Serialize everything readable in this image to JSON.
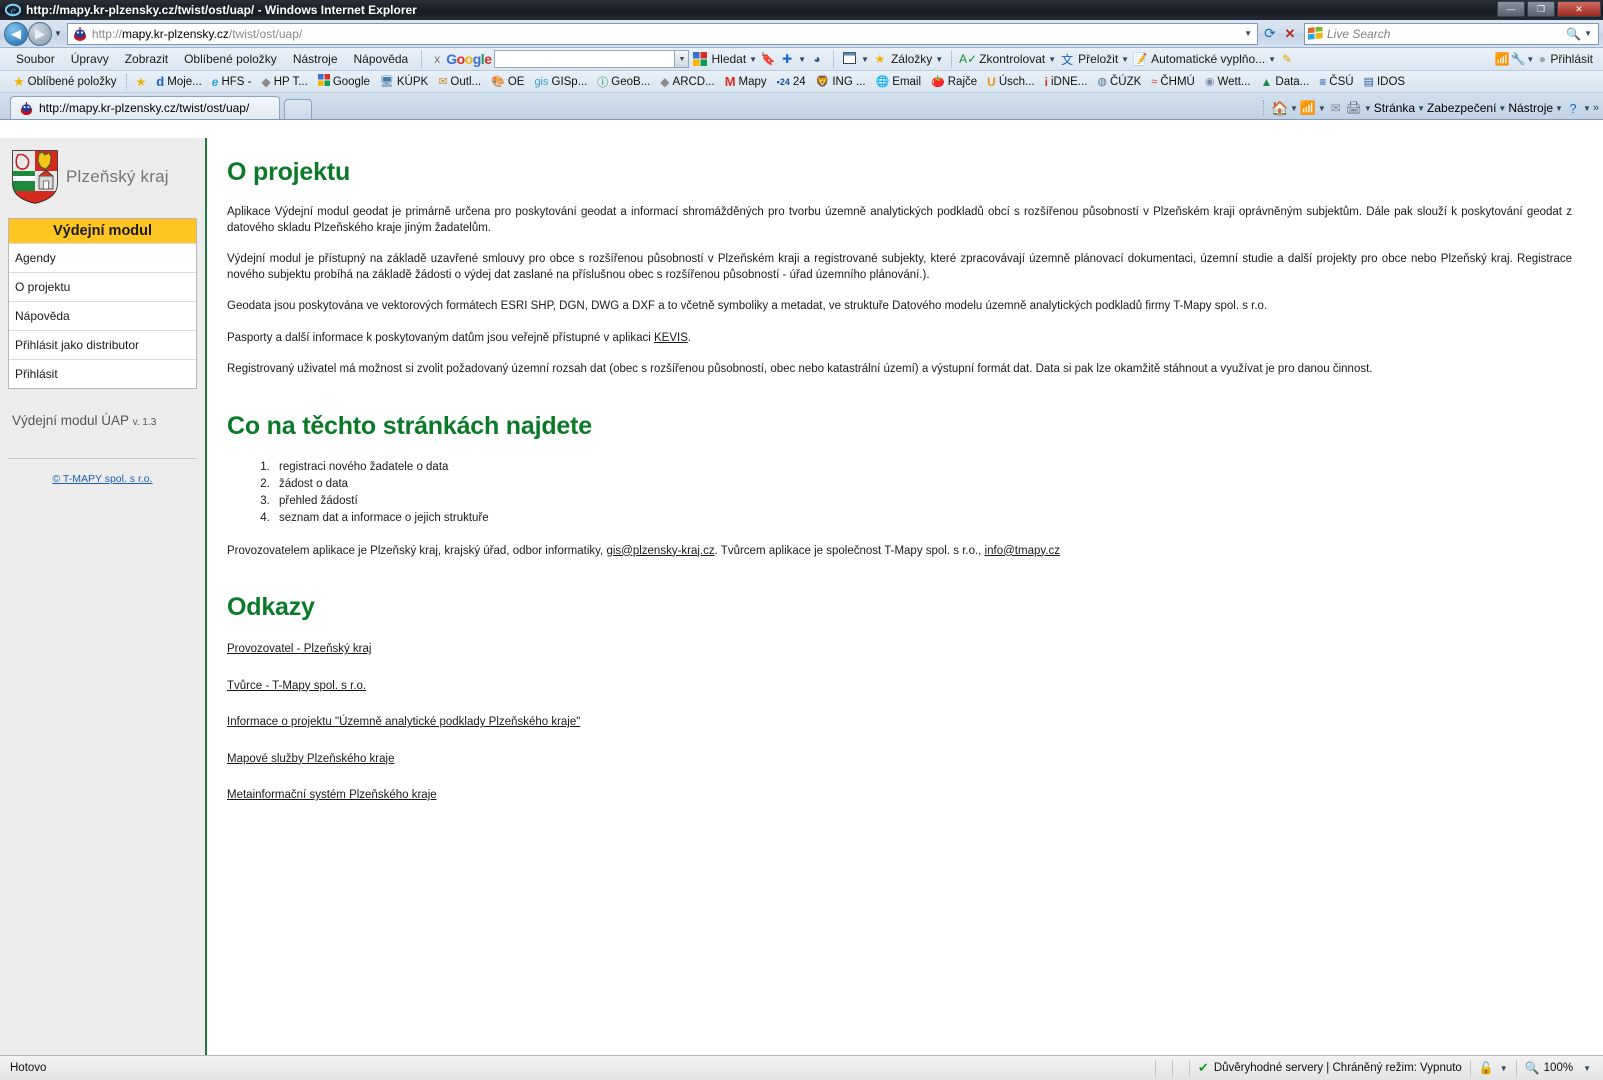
{
  "window": {
    "title": "http://mapy.kr-plzensky.cz/twist/ost/uap/ - Windows Internet Explorer",
    "minimize_label": "—",
    "maximize_label": "❐",
    "close_label": "✕"
  },
  "address_bar": {
    "url_prefix": "http://",
    "url_host": "mapy.kr-plzensky.cz",
    "url_path": "/twist/ost/uap/",
    "full_url": "http://mapy.kr-plzensky.cz/twist/ost/uap/",
    "back_icon": "back-arrow-icon",
    "forward_icon": "forward-arrow-icon",
    "history_dropdown_icon": "chevron-down-icon",
    "address_dropdown_icon": "chevron-down-icon",
    "refresh_icon": "refresh-icon",
    "stop_icon": "stop-icon",
    "search_placeholder": "Live Search",
    "search_icon": "magnifier-icon",
    "search_dropdown_icon": "chevron-down-icon"
  },
  "menu": {
    "items": [
      "Soubor",
      "Úpravy",
      "Zobrazit",
      "Oblíbené položky",
      "Nástroje",
      "Nápověda"
    ]
  },
  "google_toolbar": {
    "close_label": "x",
    "logo_letters": [
      "G",
      "o",
      "o",
      "g",
      "l",
      "e"
    ],
    "search_value": "",
    "search_dropdown_icon": "chevron-down-icon",
    "buttons": [
      {
        "label": "Hledat",
        "icon": "google-search-icon",
        "caret": true
      },
      {
        "label": "",
        "icon": "bookmarks-star-icon",
        "caret": false
      },
      {
        "label": "",
        "icon": "blue-plus-icon",
        "caret": true
      },
      {
        "label": "",
        "icon": "globe-icon",
        "caret": false
      },
      {
        "label": "",
        "icon": "popup-blocker-icon",
        "caret": true
      },
      {
        "label": "Záložky",
        "icon": "star-icon",
        "caret": true
      },
      {
        "label": "Zkontrolovat",
        "icon": "spellcheck-icon",
        "caret": true
      },
      {
        "label": "Přeložit",
        "icon": "translate-icon",
        "caret": true
      },
      {
        "label": "Automatické vyplňo...",
        "icon": "autofill-icon",
        "caret": true
      },
      {
        "label": "",
        "icon": "pencil-icon",
        "caret": false
      }
    ],
    "right_items": [
      {
        "label": "",
        "icon": "wifi-icon",
        "caret": false
      },
      {
        "label": "",
        "icon": "wrench-icon",
        "caret": true
      },
      {
        "label": "Přihlásit",
        "icon": "account-icon",
        "caret": true
      }
    ]
  },
  "favorites_bar": {
    "button_label": "Oblíbené položky",
    "button_icon": "star-icon",
    "add_icon": "add-favorite-icon",
    "items": [
      {
        "label": "Moje...",
        "icon": "d-blue-icon"
      },
      {
        "label": "HFS -",
        "icon": "ie-icon"
      },
      {
        "label": "HP T...",
        "icon": "diamond-grey-icon"
      },
      {
        "label": "Google",
        "icon": "google-g-icon"
      },
      {
        "label": "KÚPK",
        "icon": "computer-icon"
      },
      {
        "label": "Outl...",
        "icon": "outlook-icon"
      },
      {
        "label": "OE",
        "icon": "outlook-express-icon"
      },
      {
        "label": "GISp...",
        "icon": "gis-text-icon"
      },
      {
        "label": "GeoB...",
        "icon": "geo-info-icon"
      },
      {
        "label": "ARCD...",
        "icon": "diamond-grey-icon"
      },
      {
        "label": "Mapy",
        "icon": "mapy-m-icon"
      },
      {
        "label": "24",
        "icon": "24-dot-icon"
      },
      {
        "label": "ING ...",
        "icon": "ing-lion-icon"
      },
      {
        "label": "Email",
        "icon": "email-globe-icon"
      },
      {
        "label": "Rajče",
        "icon": "tomato-icon"
      },
      {
        "label": "Úsch...",
        "icon": "uschovna-icon"
      },
      {
        "label": "iDNE...",
        "icon": "idnes-icon"
      },
      {
        "label": "ČÚZK",
        "icon": "cuzk-globe-icon"
      },
      {
        "label": "ČHMÚ",
        "icon": "chmu-icon"
      },
      {
        "label": "Wett...",
        "icon": "weather-icon"
      },
      {
        "label": "Data...",
        "icon": "green-tree-icon"
      },
      {
        "label": "ČSÚ",
        "icon": "csu-icon"
      },
      {
        "label": "IDOS",
        "icon": "idos-icon"
      }
    ]
  },
  "tabs": [
    {
      "label": "http://mapy.kr-plzensky.cz/twist/ost/uap/",
      "icon": "site-icon",
      "active": true
    }
  ],
  "new_tab_label": "",
  "command_bar": {
    "items": [
      {
        "label": "",
        "icon": "home-icon",
        "caret": true
      },
      {
        "label": "",
        "icon": "rss-feed-icon",
        "caret": true
      },
      {
        "label": "",
        "icon": "mail-icon",
        "caret": false
      },
      {
        "label": "",
        "icon": "printer-icon",
        "caret": true
      },
      {
        "label": "Stránka",
        "icon": "",
        "caret": true
      },
      {
        "label": "Zabezpečení",
        "icon": "",
        "caret": true
      },
      {
        "label": "Nástroje",
        "icon": "",
        "caret": true
      },
      {
        "label": "",
        "icon": "help-icon",
        "caret": true
      }
    ],
    "overflow_label": "»"
  },
  "sidebar": {
    "logo_alt": "Plzeňský kraj coat of arms",
    "brand": "Plzeňský kraj",
    "menu_title": "Výdejní modul",
    "items": [
      {
        "label": "Agendy"
      },
      {
        "label": "O projektu"
      },
      {
        "label": "Nápověda"
      },
      {
        "label": "Přihlásit jako distributor"
      },
      {
        "label": "Přihlásit"
      }
    ],
    "version_text": "Výdejní modul ÚAP",
    "version_number": "v. 1.3",
    "copyright": "© T-MAPY spol. s r.o."
  },
  "content": {
    "heading1": "O projektu",
    "paragraphs": [
      "Aplikace Výdejní modul geodat je primárně určena pro poskytování geodat a informací shromážděných pro tvorbu územně analytických podkladů obcí s rozšířenou působností v Plzeňském kraji oprávněným subjektům. Dále pak slouží k poskytování geodat z datového skladu Plzeňského kraje jiným žadatelům.",
      "Výdejní modul je přístupný na základě uzavřené smlouvy pro obce s rozšířenou působností v Plzeňském kraji a registrované subjekty, které zpracovávají územně plánovací dokumentaci, územní studie a další projekty pro obce nebo Plzeňský kraj. Registrace nového subjektu probíhá na základě žádosti o výdej dat zaslané na příslušnou obec s rozšířenou působností - úřad územního plánování.).",
      "Geodata jsou poskytována ve vektorových formátech ESRI SHP, DGN, DWG a DXF a to včetně symboliky a metadat, ve struktuře Datového modelu územně analytických podkladů firmy T-Mapy spol. s r.o."
    ],
    "pasporty_prefix": "Pasporty a další informace k poskytovaným datům jsou veřejně přístupné v aplikaci ",
    "pasporty_link": "KEVIS",
    "pasporty_suffix": ".",
    "registered_paragraph": "Registrovaný uživatel má možnost si zvolit požadovaný územní rozsah dat (obec s rozšířenou působností, obec nebo katastrální území) a výstupní formát dat. Data si pak lze okamžitě stáhnout a využívat je pro danou činnost.",
    "heading2": "Co na těchto stránkách najdete",
    "list": [
      "registraci nového žadatele o data",
      "žádost o data",
      "přehled žádostí",
      "seznam dat a informace o jejich struktuře"
    ],
    "operator_p1": "Provozovatelem aplikace je Plzeňský kraj, krajský úřad, odbor informatiky, ",
    "operator_email1": "gis@plzensky-kraj.cz",
    "operator_p2": ". Tvůrcem aplikace je společnost T-Mapy spol. s r.o., ",
    "operator_email2": "info@tmapy.cz",
    "heading3": "Odkazy",
    "links": [
      "Provozovatel - Plzeňský kraj",
      "Tvůrce - T-Mapy spol. s r.o.",
      "Informace o projektu \"Územně analytické podklady Plzeňského kraje\"",
      "Mapové služby Plzeňského kraje",
      "Metainformační systém Plzeňského kraje"
    ]
  },
  "statusbar": {
    "status_text": "Hotovo",
    "zone_icon": "green-check-icon",
    "zone_text": "Důvěryhodné servery | Chráněný režim: Vypnuto",
    "zone_lock_icon": "zone-lock-icon",
    "zone_caret_icon": "chevron-down-icon",
    "zoom_icon": "zoom-magnifier-icon",
    "zoom_level": "100%",
    "zoom_caret_icon": "chevron-down-icon"
  },
  "colors": {
    "accent_green": "#0a7a28",
    "menu_head_yellow": "#ffc520",
    "sidebar_bg": "#ececec",
    "link_blue": "#1a5fb4"
  }
}
